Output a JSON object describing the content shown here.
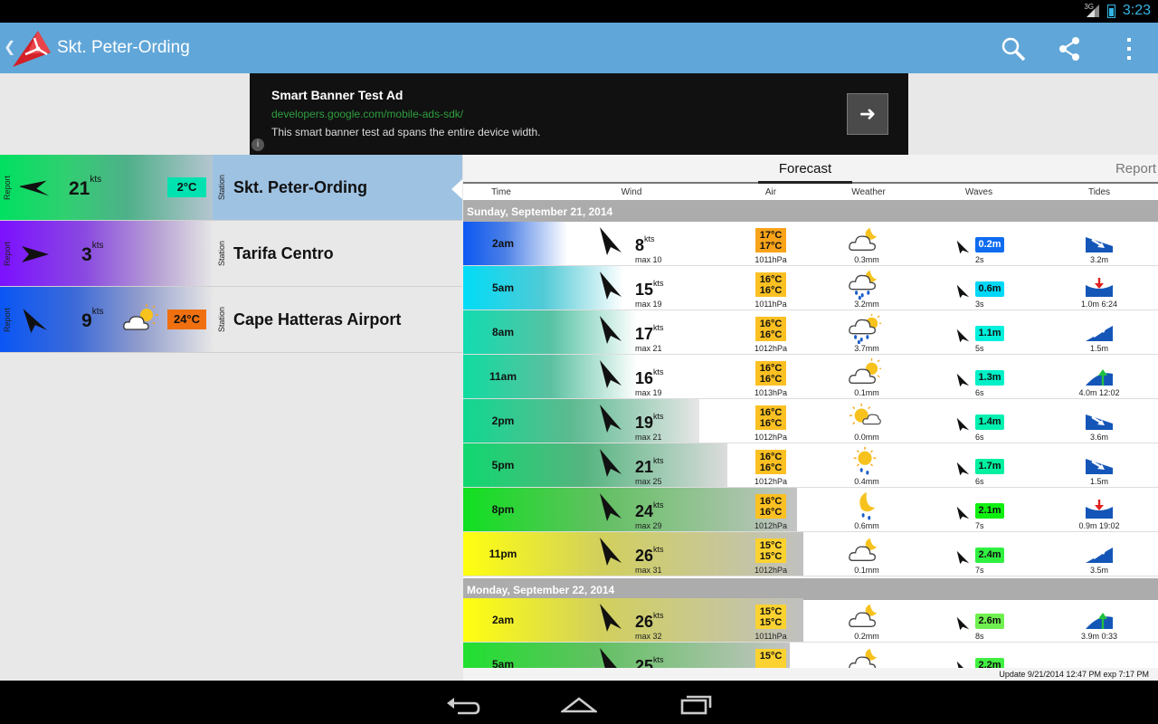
{
  "status": {
    "time": "3:23",
    "network": "3G",
    "color": "#33b5e5"
  },
  "app": {
    "title": "Skt. Peter-Ording",
    "search_icon": "search-icon",
    "share_icon": "share-icon",
    "menu_icon": "overflow-menu-icon"
  },
  "ad": {
    "title": "Smart Banner Test Ad",
    "url": "developers.google.com/mobile-ads-sdk/",
    "description": "This smart banner test ad spans the entire device width.",
    "button_icon": "arrow-right-icon",
    "info_icon": "info-icon"
  },
  "stations": [
    {
      "type": "Report",
      "speed": "21",
      "unit": "kts",
      "temp": "2°C",
      "temp_color": "#00e3b0",
      "kind": "Station",
      "name": "Skt. Peter-Ording",
      "selected": true,
      "gradient": "linear-gradient(90deg,#00e060 0%,#2fd070 30%,#4fb08a 60%,#b5c5d0 100%)",
      "weather": ""
    },
    {
      "type": "Report",
      "speed": "3",
      "unit": "kts",
      "temp": "",
      "temp_color": "",
      "kind": "Station",
      "name": "Tarifa Centro",
      "selected": false,
      "gradient": "linear-gradient(90deg,#7c10ff 0%,#8a4ae0 40%,#b9a4d4 75%,#e6e6e6 100%)",
      "weather": ""
    },
    {
      "type": "Report",
      "speed": "9",
      "unit": "kts",
      "temp": "24°C",
      "temp_color": "#f07010",
      "kind": "Station",
      "name": "Cape Hatteras Airport",
      "selected": false,
      "gradient": "linear-gradient(90deg,#0a56f5 0%,#3c6ad8 35%,#8f9bcc 65%,#e6e6e6 100%)",
      "weather": "partly-sunny-icon"
    }
  ],
  "tabs": {
    "forecast": "Forecast",
    "report": "Report"
  },
  "columns": {
    "time": "Time",
    "wind": "Wind",
    "air": "Air",
    "weather": "Weather",
    "waves": "Waves",
    "tides": "Tides"
  },
  "days": [
    {
      "label": "Sunday, September 21, 2014"
    },
    {
      "label": "Monday, September 22, 2014"
    }
  ],
  "rows": [
    {
      "time": "2am",
      "speed": "8",
      "unit": "kts",
      "max": "max 10",
      "air1": "17°C",
      "air2": "17°C",
      "air_color": "#f9a31a",
      "pressure": "1011hPa",
      "weather": "cloud-moon-icon",
      "precip": "0.3mm",
      "wave": "0.2m",
      "wave_color": "#0d6cf0",
      "wave_text": "#ffffff",
      "period": "2s",
      "tide_icon": "tide-falling-icon",
      "tide": "3.2m",
      "grad_w": 0.15,
      "grad": "linear-gradient(90deg,#0c58f2,#4b7fe6 40%,#ffffff)"
    },
    {
      "time": "5am",
      "speed": "15",
      "unit": "kts",
      "max": "max 19",
      "air1": "16°C",
      "air2": "16°C",
      "air_color": "#fbc022",
      "pressure": "1011hPa",
      "weather": "rain-moon-icon",
      "precip": "3.2mm",
      "wave": "0.6m",
      "wave_color": "#00d8f8",
      "wave_text": "#111111",
      "period": "3s",
      "tide_icon": "tide-low-icon",
      "tide": "1.0m 6:24",
      "grad_w": 0.23,
      "grad": "linear-gradient(90deg,#00dcf6,#51cad6 50%,#ffffff)"
    },
    {
      "time": "8am",
      "speed": "17",
      "unit": "kts",
      "max": "max 21",
      "air1": "16°C",
      "air2": "16°C",
      "air_color": "#fbc022",
      "pressure": "1012hPa",
      "weather": "rain-sun-icon",
      "precip": "3.7mm",
      "wave": "1.1m",
      "wave_color": "#00f0dc",
      "wave_text": "#111111",
      "period": "5s",
      "tide_icon": "tide-rising-icon",
      "tide": "1.5m",
      "grad_w": 0.25,
      "grad": "linear-gradient(90deg,#11dcb0,#56c2a4 50%,#ffffff)"
    },
    {
      "time": "11am",
      "speed": "16",
      "unit": "kts",
      "max": "max 19",
      "air1": "16°C",
      "air2": "16°C",
      "air_color": "#fbc022",
      "pressure": "1013hPa",
      "weather": "partly-sunny-icon",
      "precip": "0.1mm",
      "wave": "1.3m",
      "wave_color": "#00f0c8",
      "wave_text": "#111111",
      "period": "6s",
      "tide_icon": "tide-high-icon",
      "tide": "4.0m 12:02",
      "grad_w": 0.25,
      "grad": "linear-gradient(90deg,#10dca0,#5ac0a0 50%,#ffffff)"
    },
    {
      "time": "2pm",
      "speed": "19",
      "unit": "kts",
      "max": "max 21",
      "air1": "16°C",
      "air2": "16°C",
      "air_color": "#fbc022",
      "pressure": "1012hPa",
      "weather": "sun-cloud-icon",
      "precip": "0.0mm",
      "wave": "1.4m",
      "wave_color": "#00f0b0",
      "wave_text": "#111111",
      "period": "6s",
      "tide_icon": "tide-falling-icon",
      "tide": "3.6m",
      "grad_w": 0.34,
      "grad": "linear-gradient(90deg,#10d890,#5bba90 45%,#e6e6e6)"
    },
    {
      "time": "5pm",
      "speed": "21",
      "unit": "kts",
      "max": "max 25",
      "air1": "16°C",
      "air2": "16°C",
      "air_color": "#fbc022",
      "pressure": "1012hPa",
      "weather": "sun-rain-icon",
      "precip": "0.4mm",
      "wave": "1.7m",
      "wave_color": "#00f0a0",
      "wave_text": "#111111",
      "period": "6s",
      "tide_icon": "tide-falling-icon",
      "tide": "1.5m",
      "grad_w": 0.38,
      "grad": "linear-gradient(90deg,#10d870,#54b47f 45%,#dcdcdc)"
    },
    {
      "time": "8pm",
      "speed": "24",
      "unit": "kts",
      "max": "max 29",
      "air1": "16°C",
      "air2": "16°C",
      "air_color": "#fbc022",
      "pressure": "1012hPa",
      "weather": "moon-rain-icon",
      "precip": "0.6mm",
      "wave": "2.1m",
      "wave_color": "#10f010",
      "wave_text": "#111111",
      "period": "7s",
      "tide_icon": "tide-low-icon",
      "tide": "0.9m 19:02",
      "grad_w": 0.48,
      "grad": "linear-gradient(90deg,#10e020,#60c060 40%,#c4c4c4)"
    },
    {
      "time": "11pm",
      "speed": "26",
      "unit": "kts",
      "max": "max 31",
      "air1": "15°C",
      "air2": "15°C",
      "air_color": "#fbd230",
      "pressure": "1012hPa",
      "weather": "cloud-moon-icon",
      "precip": "0.1mm",
      "wave": "2.4m",
      "wave_color": "#30f040",
      "wave_text": "#111111",
      "period": "7s",
      "tide_icon": "tide-rising-icon",
      "tide": "3.5m",
      "grad_w": 0.49,
      "grad": "linear-gradient(90deg,#ffff10,#d2d05c 40%,#c0c0c0)"
    },
    {
      "time": "2am",
      "speed": "26",
      "unit": "kts",
      "max": "max 32",
      "air1": "15°C",
      "air2": "15°C",
      "air_color": "#fbd230",
      "pressure": "1011hPa",
      "weather": "cloud-moon-icon",
      "precip": "0.2mm",
      "wave": "2.6m",
      "wave_color": "#70f050",
      "wave_text": "#111111",
      "period": "8s",
      "tide_icon": "tide-high-icon",
      "tide": "3.9m 0:33",
      "grad_w": 0.49,
      "grad": "linear-gradient(90deg,#ffff10,#d2d05c 40%,#c0c0c0)"
    },
    {
      "time": "5am",
      "speed": "25",
      "unit": "kts",
      "max": "",
      "air1": "15°C",
      "air2": "",
      "air_color": "#fbd230",
      "pressure": "",
      "weather": "cloud-moon-icon",
      "precip": "",
      "wave": "2.2m",
      "wave_color": "#40f040",
      "wave_text": "#111111",
      "period": "",
      "tide_icon": "",
      "tide": "",
      "grad_w": 0.47,
      "grad": "linear-gradient(90deg,#20e030,#60c060 40%,#c4c4c4)"
    }
  ],
  "update": "Update 9/21/2014 12:47 PM exp 7:17 PM",
  "nav": {
    "back_icon": "back-icon",
    "home_icon": "home-icon",
    "recents_icon": "recents-icon"
  }
}
